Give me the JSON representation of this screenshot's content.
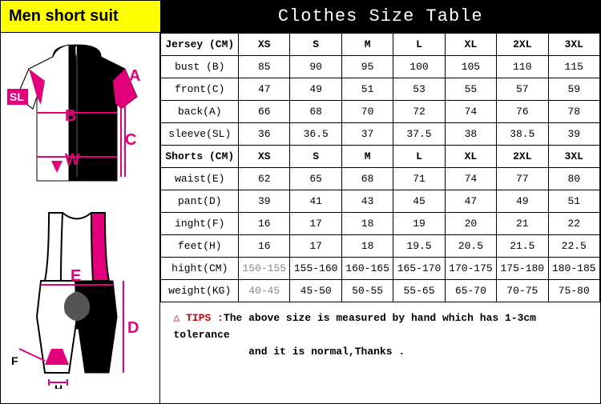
{
  "banner": {
    "left": "Men short suit",
    "right": "Clothes Size Table"
  },
  "chart_data": [
    {
      "type": "table",
      "title": "Jersey (CM)",
      "columns": [
        "XS",
        "S",
        "M",
        "L",
        "XL",
        "2XL",
        "3XL"
      ],
      "rows": [
        {
          "label": "bust (B)",
          "values": [
            "85",
            "90",
            "95",
            "100",
            "105",
            "110",
            "115"
          ]
        },
        {
          "label": "front(C)",
          "values": [
            "47",
            "49",
            "51",
            "53",
            "55",
            "57",
            "59"
          ]
        },
        {
          "label": "back(A)",
          "values": [
            "66",
            "68",
            "70",
            "72",
            "74",
            "76",
            "78"
          ]
        },
        {
          "label": "sleeve(SL)",
          "values": [
            "36",
            "36.5",
            "37",
            "37.5",
            "38",
            "38.5",
            "39"
          ]
        }
      ]
    },
    {
      "type": "table",
      "title": "Shorts (CM)",
      "columns": [
        "XS",
        "S",
        "M",
        "L",
        "XL",
        "2XL",
        "3XL"
      ],
      "rows": [
        {
          "label": "waist(E)",
          "values": [
            "62",
            "65",
            "68",
            "71",
            "74",
            "77",
            "80"
          ]
        },
        {
          "label": "pant(D)",
          "values": [
            "39",
            "41",
            "43",
            "45",
            "47",
            "49",
            "51"
          ]
        },
        {
          "label": "inght(F)",
          "values": [
            "16",
            "17",
            "18",
            "19",
            "20",
            "21",
            "22"
          ]
        },
        {
          "label": "feet(H)",
          "values": [
            "16",
            "17",
            "18",
            "19.5",
            "20.5",
            "21.5",
            "22.5"
          ]
        },
        {
          "label": "hight(CM)",
          "values": [
            "150-155",
            "155-160",
            "160-165",
            "165-170",
            "170-175",
            "175-180",
            "180-185"
          ],
          "grey_first": true
        },
        {
          "label": "weight(KG)",
          "values": [
            "40-45",
            "45-50",
            "50-55",
            "55-65",
            "65-70",
            "70-75",
            "75-80"
          ],
          "grey_first": true
        }
      ]
    }
  ],
  "diagram": {
    "labels": {
      "A": "A",
      "B": "B",
      "C": "C",
      "D": "D",
      "E": "E",
      "F": "F",
      "H": "H",
      "W": "W",
      "SL": "SL"
    }
  },
  "tips": {
    "icon": "△",
    "label": "TIPS :",
    "text1": "The above size is measured by hand which has 1-3cm tolerance",
    "text2": "and it is normal,Thanks ."
  }
}
